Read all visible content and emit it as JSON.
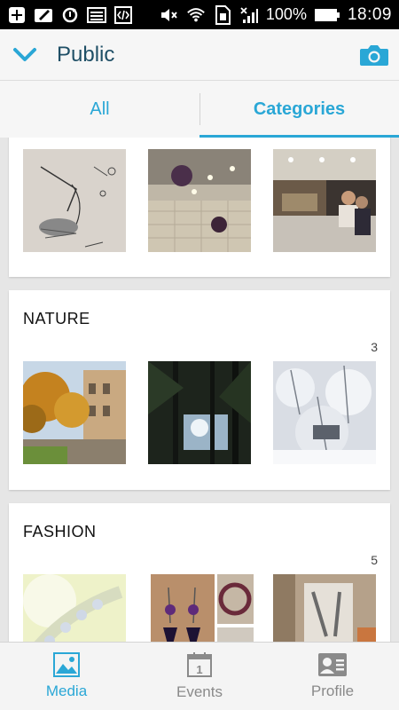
{
  "status_bar": {
    "left_icons": [
      "add-icon",
      "edit-icon",
      "sync-icon",
      "image-icon",
      "code-icon"
    ],
    "right_icons": [
      "mute-icon",
      "wifi-icon",
      "sim-icon",
      "signal-icon",
      "battery-icon"
    ],
    "battery": "100%",
    "time": "18:09"
  },
  "app_bar": {
    "title": "Public",
    "back_icon": "chevron-down-icon",
    "action_icon": "camera-icon"
  },
  "tabs": [
    {
      "label": "All",
      "active": false
    },
    {
      "label": "Categories",
      "active": true
    }
  ],
  "categories": [
    {
      "title": "",
      "count": "",
      "thumbs": [
        "sketch-drawing",
        "cafe-ceiling-lamps",
        "bakery-counter"
      ]
    },
    {
      "title": "NATURE",
      "count": "3",
      "thumbs": [
        "autumn-street",
        "forest-trees",
        "snowy-trees"
      ]
    },
    {
      "title": "FASHION",
      "count": "5",
      "thumbs": [
        "bracelet",
        "earrings-collage",
        "shop-display"
      ]
    }
  ],
  "bottom_nav": [
    {
      "label": "Media",
      "icon": "media-icon",
      "active": true
    },
    {
      "label": "Events",
      "icon": "calendar-icon",
      "active": false,
      "badge": "1"
    },
    {
      "label": "Profile",
      "icon": "profile-card-icon",
      "active": false
    }
  ],
  "colors": {
    "accent": "#2aa7d6",
    "title": "#1f4f66",
    "inactive": "#8a8a8a"
  }
}
